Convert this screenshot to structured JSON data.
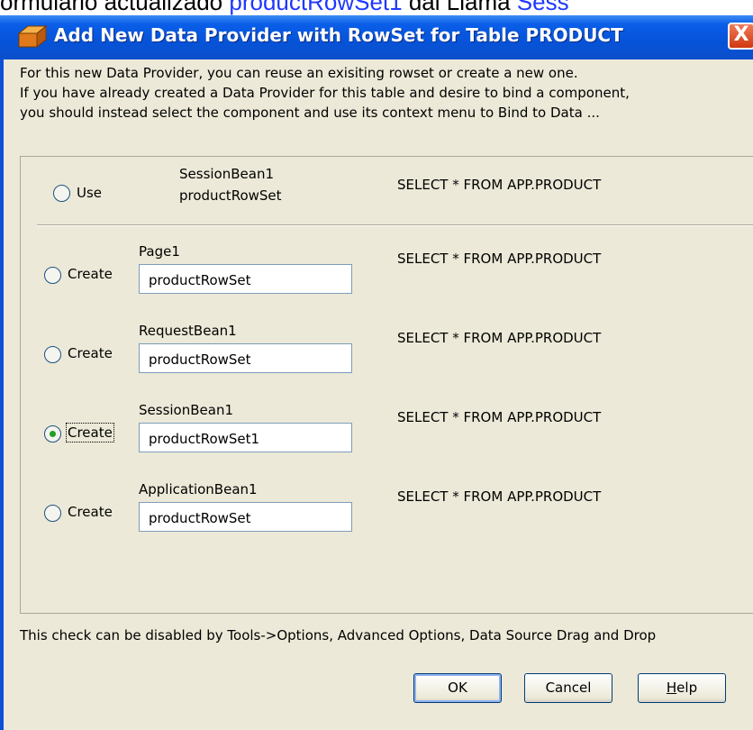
{
  "background": {
    "prefix": "ormulario actualizado",
    "link1": "productRowSet1",
    "middle": " dal Llama ",
    "link2": "Sess"
  },
  "dialog": {
    "title": "Add New Data Provider with RowSet for Table PRODUCT",
    "close_label": "X",
    "intro": [
      "For this new Data Provider, you can reuse an exisiting rowset or create a new one.",
      "If you have already created a Data Provider for this table and desire to bind a component,",
      "you should instead select the component and use its context menu to Bind to Data ..."
    ],
    "use_option": {
      "label": "Use",
      "bean": "SessionBean1",
      "rowset": "productRowSet",
      "query": "SELECT * FROM APP.PRODUCT"
    },
    "create_options": [
      {
        "label": "Create",
        "bean": "Page1",
        "rowset": "productRowSet",
        "query": "SELECT * FROM APP.PRODUCT",
        "selected": false
      },
      {
        "label": "Create",
        "bean": "RequestBean1",
        "rowset": "productRowSet",
        "query": "SELECT * FROM APP.PRODUCT",
        "selected": false
      },
      {
        "label": "Create",
        "bean": "SessionBean1",
        "rowset": "productRowSet1",
        "query": "SELECT * FROM APP.PRODUCT",
        "selected": true
      },
      {
        "label": "Create",
        "bean": "ApplicationBean1",
        "rowset": "productRowSet",
        "query": "SELECT * FROM APP.PRODUCT",
        "selected": false
      }
    ],
    "footer_note": "This check can be disabled by Tools->Options, Advanced Options, Data Source Drag and Drop",
    "buttons": {
      "ok": "OK",
      "cancel": "Cancel",
      "help_mnemonic": "H",
      "help_rest": "elp"
    }
  },
  "colors": {
    "titlebar": "#0653d8",
    "client": "#ece9d8",
    "radio_selected_dot": "#21a121",
    "link": "#1f37ff"
  }
}
